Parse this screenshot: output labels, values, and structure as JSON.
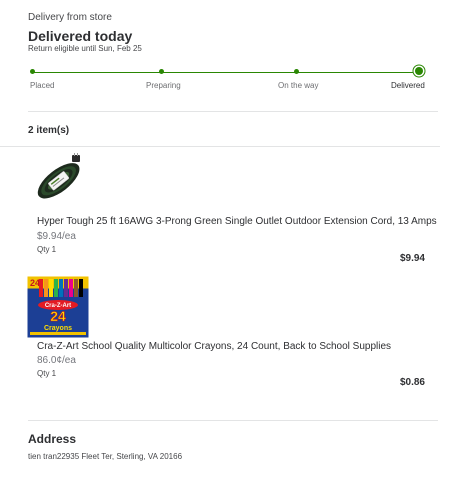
{
  "header": {
    "delivery_type": "Delivery from store",
    "status_title": "Delivered today",
    "return_note": "Return eligible until Sun, Feb 25"
  },
  "progress": {
    "steps": [
      "Placed",
      "Preparing",
      "On the way",
      "Delivered"
    ],
    "current_step": "Delivered",
    "color": "#2a8703"
  },
  "items_header": "2 item(s)",
  "items": [
    {
      "name": "Hyper Tough 25 ft 16AWG 3-Prong Green Single Outlet Outdoor Extension Cord, 13 Amps",
      "unit_price": "$9.94/ea",
      "qty": "Qty 1",
      "total": "$9.94",
      "thumbnail_icon": "extension-cord-image"
    },
    {
      "name": "Cra-Z-Art School Quality Multicolor Crayons, 24 Count, Back to School Supplies",
      "unit_price": "86.0¢/ea",
      "qty": "Qty 1",
      "total": "$0.86",
      "thumbnail_icon": "crayons-box-image",
      "thumbnail_text": {
        "count": "24",
        "brand": "Cra-Z-Art",
        "product": "Crayons"
      }
    }
  ],
  "address": {
    "title": "Address",
    "text": "tien tran22935 Fleet Ter, Sterling, VA 20166"
  }
}
